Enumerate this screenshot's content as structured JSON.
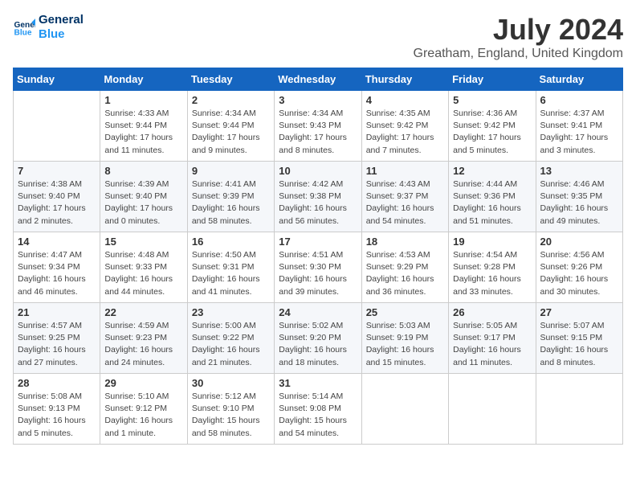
{
  "header": {
    "logo_line1": "General",
    "logo_line2": "Blue",
    "month_year": "July 2024",
    "location": "Greatham, England, United Kingdom"
  },
  "days_of_week": [
    "Sunday",
    "Monday",
    "Tuesday",
    "Wednesday",
    "Thursday",
    "Friday",
    "Saturday"
  ],
  "weeks": [
    [
      {
        "day": "",
        "info": ""
      },
      {
        "day": "1",
        "info": "Sunrise: 4:33 AM\nSunset: 9:44 PM\nDaylight: 17 hours\nand 11 minutes."
      },
      {
        "day": "2",
        "info": "Sunrise: 4:34 AM\nSunset: 9:44 PM\nDaylight: 17 hours\nand 9 minutes."
      },
      {
        "day": "3",
        "info": "Sunrise: 4:34 AM\nSunset: 9:43 PM\nDaylight: 17 hours\nand 8 minutes."
      },
      {
        "day": "4",
        "info": "Sunrise: 4:35 AM\nSunset: 9:42 PM\nDaylight: 17 hours\nand 7 minutes."
      },
      {
        "day": "5",
        "info": "Sunrise: 4:36 AM\nSunset: 9:42 PM\nDaylight: 17 hours\nand 5 minutes."
      },
      {
        "day": "6",
        "info": "Sunrise: 4:37 AM\nSunset: 9:41 PM\nDaylight: 17 hours\nand 3 minutes."
      }
    ],
    [
      {
        "day": "7",
        "info": "Sunrise: 4:38 AM\nSunset: 9:40 PM\nDaylight: 17 hours\nand 2 minutes."
      },
      {
        "day": "8",
        "info": "Sunrise: 4:39 AM\nSunset: 9:40 PM\nDaylight: 17 hours\nand 0 minutes."
      },
      {
        "day": "9",
        "info": "Sunrise: 4:41 AM\nSunset: 9:39 PM\nDaylight: 16 hours\nand 58 minutes."
      },
      {
        "day": "10",
        "info": "Sunrise: 4:42 AM\nSunset: 9:38 PM\nDaylight: 16 hours\nand 56 minutes."
      },
      {
        "day": "11",
        "info": "Sunrise: 4:43 AM\nSunset: 9:37 PM\nDaylight: 16 hours\nand 54 minutes."
      },
      {
        "day": "12",
        "info": "Sunrise: 4:44 AM\nSunset: 9:36 PM\nDaylight: 16 hours\nand 51 minutes."
      },
      {
        "day": "13",
        "info": "Sunrise: 4:46 AM\nSunset: 9:35 PM\nDaylight: 16 hours\nand 49 minutes."
      }
    ],
    [
      {
        "day": "14",
        "info": "Sunrise: 4:47 AM\nSunset: 9:34 PM\nDaylight: 16 hours\nand 46 minutes."
      },
      {
        "day": "15",
        "info": "Sunrise: 4:48 AM\nSunset: 9:33 PM\nDaylight: 16 hours\nand 44 minutes."
      },
      {
        "day": "16",
        "info": "Sunrise: 4:50 AM\nSunset: 9:31 PM\nDaylight: 16 hours\nand 41 minutes."
      },
      {
        "day": "17",
        "info": "Sunrise: 4:51 AM\nSunset: 9:30 PM\nDaylight: 16 hours\nand 39 minutes."
      },
      {
        "day": "18",
        "info": "Sunrise: 4:53 AM\nSunset: 9:29 PM\nDaylight: 16 hours\nand 36 minutes."
      },
      {
        "day": "19",
        "info": "Sunrise: 4:54 AM\nSunset: 9:28 PM\nDaylight: 16 hours\nand 33 minutes."
      },
      {
        "day": "20",
        "info": "Sunrise: 4:56 AM\nSunset: 9:26 PM\nDaylight: 16 hours\nand 30 minutes."
      }
    ],
    [
      {
        "day": "21",
        "info": "Sunrise: 4:57 AM\nSunset: 9:25 PM\nDaylight: 16 hours\nand 27 minutes."
      },
      {
        "day": "22",
        "info": "Sunrise: 4:59 AM\nSunset: 9:23 PM\nDaylight: 16 hours\nand 24 minutes."
      },
      {
        "day": "23",
        "info": "Sunrise: 5:00 AM\nSunset: 9:22 PM\nDaylight: 16 hours\nand 21 minutes."
      },
      {
        "day": "24",
        "info": "Sunrise: 5:02 AM\nSunset: 9:20 PM\nDaylight: 16 hours\nand 18 minutes."
      },
      {
        "day": "25",
        "info": "Sunrise: 5:03 AM\nSunset: 9:19 PM\nDaylight: 16 hours\nand 15 minutes."
      },
      {
        "day": "26",
        "info": "Sunrise: 5:05 AM\nSunset: 9:17 PM\nDaylight: 16 hours\nand 11 minutes."
      },
      {
        "day": "27",
        "info": "Sunrise: 5:07 AM\nSunset: 9:15 PM\nDaylight: 16 hours\nand 8 minutes."
      }
    ],
    [
      {
        "day": "28",
        "info": "Sunrise: 5:08 AM\nSunset: 9:13 PM\nDaylight: 16 hours\nand 5 minutes."
      },
      {
        "day": "29",
        "info": "Sunrise: 5:10 AM\nSunset: 9:12 PM\nDaylight: 16 hours\nand 1 minute."
      },
      {
        "day": "30",
        "info": "Sunrise: 5:12 AM\nSunset: 9:10 PM\nDaylight: 15 hours\nand 58 minutes."
      },
      {
        "day": "31",
        "info": "Sunrise: 5:14 AM\nSunset: 9:08 PM\nDaylight: 15 hours\nand 54 minutes."
      },
      {
        "day": "",
        "info": ""
      },
      {
        "day": "",
        "info": ""
      },
      {
        "day": "",
        "info": ""
      }
    ]
  ]
}
